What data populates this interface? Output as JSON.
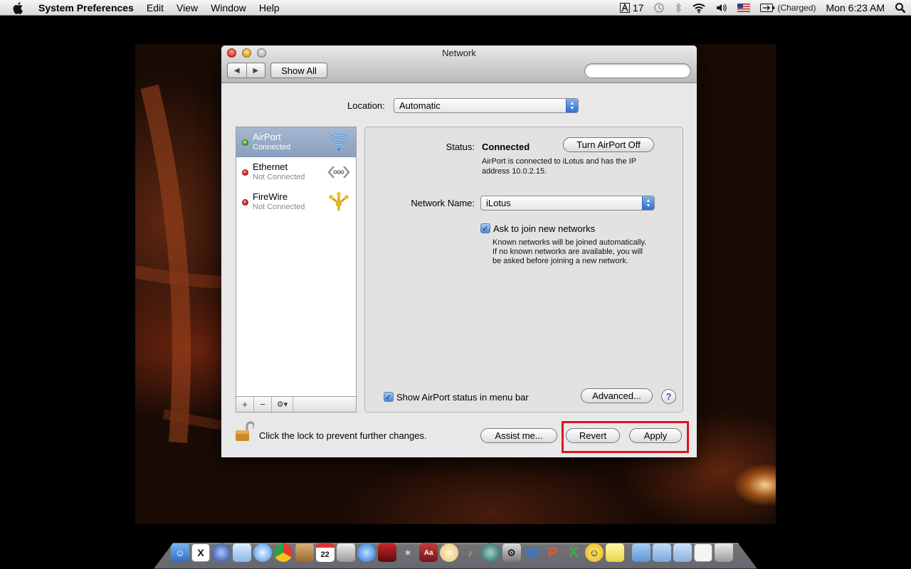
{
  "menubar": {
    "app_name": "System Preferences",
    "menus": [
      "Edit",
      "View",
      "Window",
      "Help"
    ],
    "status_number": "17",
    "battery_status": "(Charged)",
    "clock": "Mon 6:23 AM"
  },
  "window": {
    "title": "Network",
    "toolbar": {
      "show_all_label": "Show All",
      "search_placeholder": ""
    },
    "location": {
      "label": "Location:",
      "value": "Automatic"
    },
    "services": [
      {
        "name": "AirPort",
        "state": "Connected",
        "status_color": "green",
        "icon": "wifi-icon",
        "selected": true
      },
      {
        "name": "Ethernet",
        "state": "Not Connected",
        "status_color": "red",
        "icon": "ethernet-icon",
        "selected": false
      },
      {
        "name": "FireWire",
        "state": "Not Connected",
        "status_color": "red",
        "icon": "firewire-icon",
        "selected": false
      }
    ],
    "list_tools": {
      "add": "+",
      "remove": "−",
      "action": "⚙▾"
    },
    "detail": {
      "status_label": "Status:",
      "status_value": "Connected",
      "turn_off_label": "Turn AirPort Off",
      "status_desc_line1": "AirPort is connected to iLotus and has the IP",
      "status_desc_line2": "address 10.0.2.15.",
      "network_name_label": "Network Name:",
      "network_name_value": "iLotus",
      "ask_join_label": "Ask to join new networks",
      "ask_join_checked": true,
      "ask_desc_line1": "Known networks will be joined automatically.",
      "ask_desc_line2": "If no known networks are available, you will",
      "ask_desc_line3": "be asked before joining a new network.",
      "show_status_label": "Show AirPort status in menu bar",
      "show_status_checked": true,
      "advanced_label": "Advanced...",
      "help_label": "?"
    },
    "footer": {
      "lock_text": "Click the lock to prevent further changes.",
      "assist_label": "Assist me...",
      "revert_label": "Revert",
      "apply_label": "Apply"
    }
  },
  "dock": {
    "icons": [
      "finder-icon",
      "x11-icon",
      "network-icon",
      "box-icon",
      "safari-icon",
      "chrome-icon",
      "address-book-icon",
      "calendar-icon",
      "preview-icon",
      "itunes-icon",
      "photo-booth-icon",
      "spaces-icon",
      "dictionary-icon",
      "globe-icon",
      "garageband-icon",
      "time-machine-icon",
      "system-preferences-icon",
      "word-icon",
      "powerpoint-icon",
      "excel-icon",
      "messenger-icon",
      "stickies-icon",
      "applications-folder-icon",
      "documents-folder-icon",
      "downloads-folder-icon",
      "notes-icon",
      "trash-icon"
    ],
    "calendar_day": "22"
  },
  "colors": {
    "highlight_box": "#e0121f",
    "selected_row": "#8aa0bf",
    "help_accent": "#7a3fc2"
  }
}
